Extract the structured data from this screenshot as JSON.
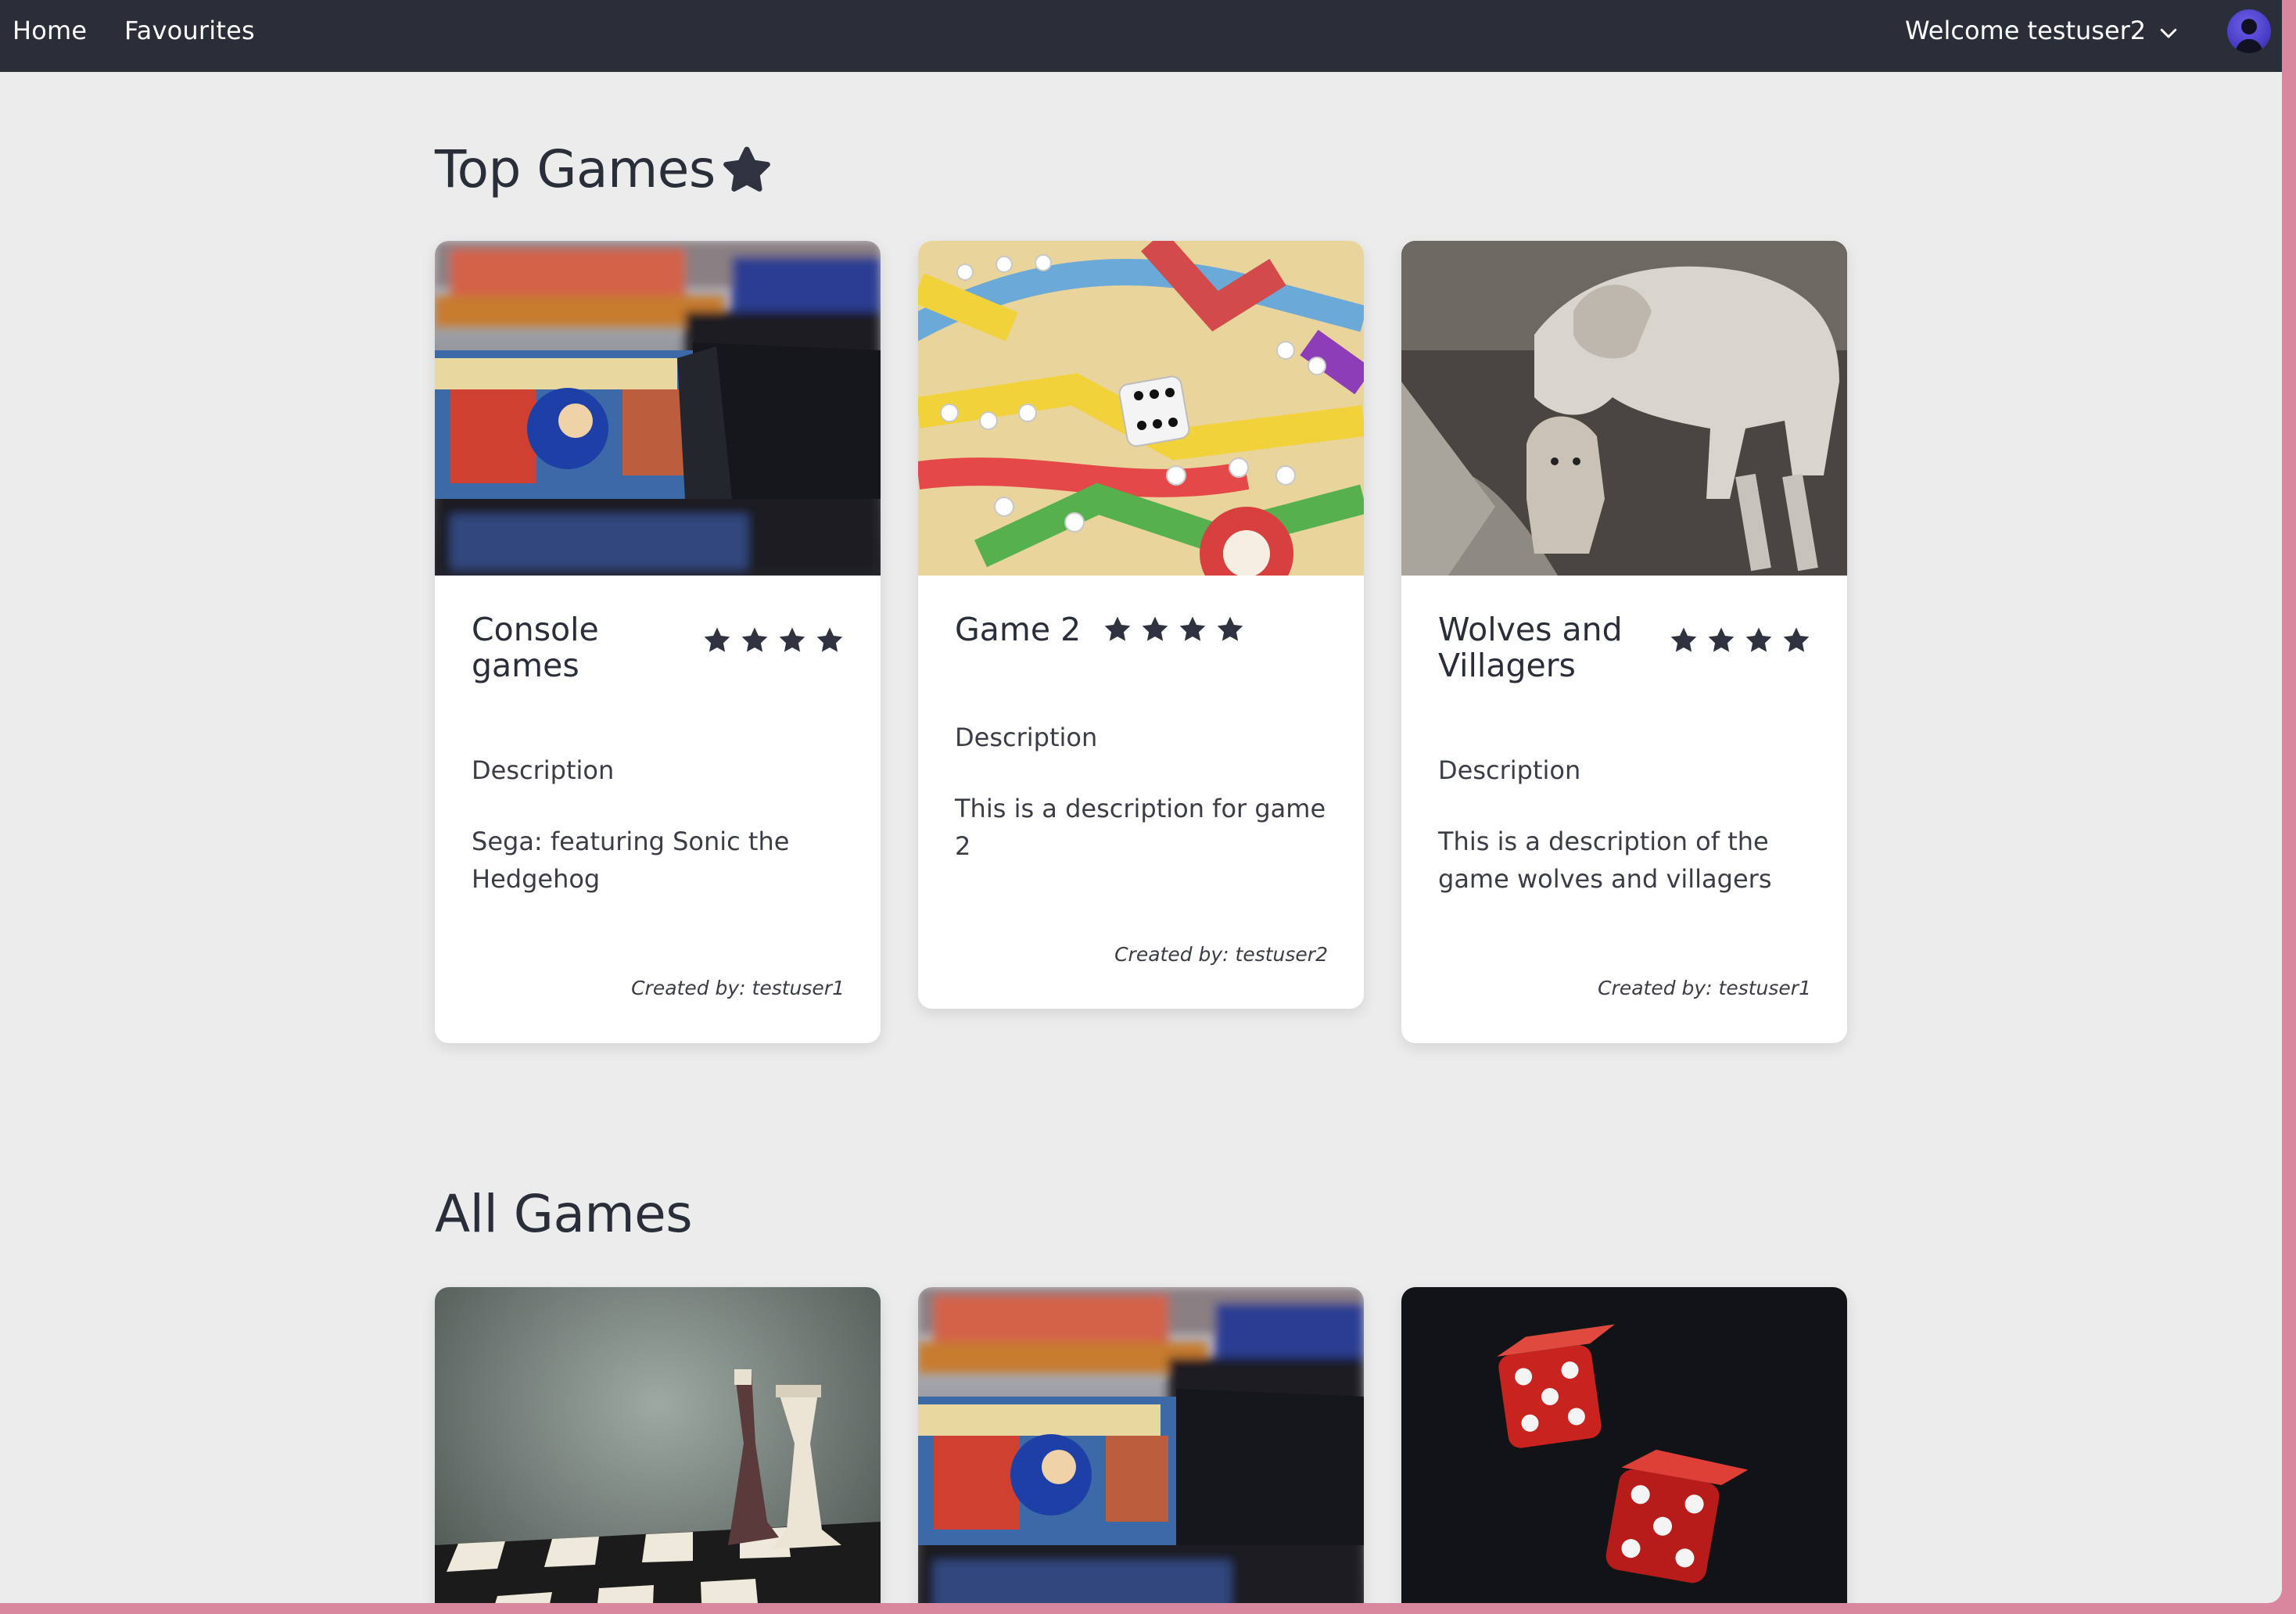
{
  "nav": {
    "home": "Home",
    "favourites": "Favourites",
    "welcome": "Welcome testuser2"
  },
  "sections": {
    "top_title": "Top Games",
    "all_title": "All Games"
  },
  "top_games": [
    {
      "title_line1": "Console",
      "title_line2": "games",
      "rating": 4,
      "description_label": "Description",
      "description": "Sega: featuring Sonic the Hedgehog",
      "created_by": "Created by: testuser1",
      "image": "console-cartridges-photo"
    },
    {
      "title_line1": "Game 2",
      "title_line2": "",
      "rating": 4,
      "description_label": "Description",
      "description": "This is a description for game 2",
      "created_by": "Created by: testuser2",
      "image": "ludo-board-dice-photo"
    },
    {
      "title_line1": "Wolves and",
      "title_line2": "Villagers",
      "rating": 4,
      "description_label": "Description",
      "description": "This is a description of the game wolves and villagers",
      "created_by": "Created by: testuser1",
      "image": "wolves-photo"
    }
  ],
  "all_games": [
    {
      "image": "chess-pieces-photo"
    },
    {
      "image": "console-cartridges-photo"
    },
    {
      "image": "red-dice-photo"
    }
  ],
  "colors": {
    "navbar": "#2a2e38",
    "page_bg": "#ececed",
    "text_dark": "#2a2e38",
    "star": "#2f3340",
    "avatar": "#5a4ad8"
  },
  "icons": {
    "chevron": "chevron-down-icon",
    "avatar": "user-avatar-icon",
    "star": "star-icon"
  }
}
